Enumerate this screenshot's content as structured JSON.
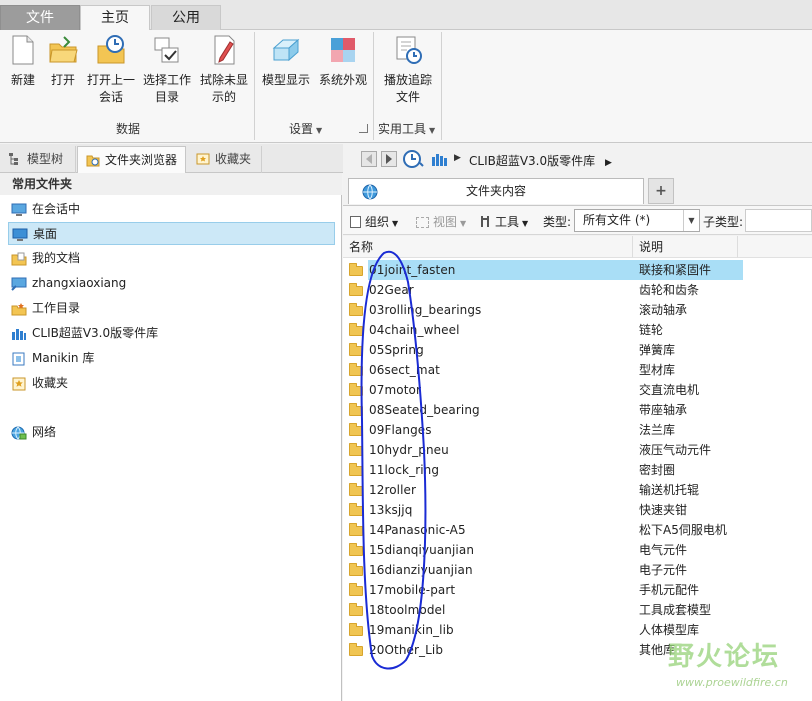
{
  "ribbon_tabs": [
    "文件",
    "主页",
    "公用"
  ],
  "ribbon": {
    "buttons": [
      {
        "label": "新建",
        "icon": "new-file-icon"
      },
      {
        "label": "打开",
        "icon": "open-folder-icon"
      },
      {
        "label": "打开上一\n会话",
        "icon": "open-last-session-icon"
      },
      {
        "label": "选择工作\n目录",
        "icon": "select-working-dir-icon"
      },
      {
        "label": "拭除未显\n示的",
        "icon": "erase-not-displayed-icon"
      },
      {
        "label": "模型显示",
        "icon": "model-display-icon"
      },
      {
        "label": "系统外观",
        "icon": "system-appearance-icon"
      },
      {
        "label": "播放追踪\n文件",
        "icon": "play-trail-file-icon"
      }
    ],
    "groups": [
      "数据",
      "设置",
      "实用工具"
    ]
  },
  "left_tabs": [
    {
      "label": "模型树",
      "icon": "model-tree-icon"
    },
    {
      "label": "文件夹浏览器",
      "icon": "folder-browser-icon"
    },
    {
      "label": "收藏夹",
      "icon": "favorites-icon"
    }
  ],
  "left_panel": {
    "header": "常用文件夹",
    "items": [
      {
        "label": "在会话中",
        "icon": "monitor-icon"
      },
      {
        "label": "桌面",
        "icon": "desktop-icon",
        "selected": true
      },
      {
        "label": "我的文档",
        "icon": "documents-icon"
      },
      {
        "label": "zhangxiaoxiang",
        "icon": "computer-icon"
      },
      {
        "label": "工作目录",
        "icon": "working-dir-icon"
      },
      {
        "label": "CLIB超蓝V3.0版零件库",
        "icon": "library-icon"
      },
      {
        "label": "Manikin 库",
        "icon": "manikin-library-icon"
      },
      {
        "label": "收藏夹",
        "icon": "favorites-icon"
      },
      {
        "label": "网络",
        "icon": "network-icon"
      }
    ]
  },
  "breadcrumb": {
    "path": "CLIB超蓝V3.0版零件库"
  },
  "content_tab": {
    "label": "文件夹内容",
    "add_label": "+"
  },
  "toolbar": {
    "organize": "组织",
    "view": "视图",
    "tools": "工具",
    "type_label": "类型:",
    "type_value": "所有文件 (*)",
    "subtype_label": "子类型:"
  },
  "columns": {
    "name": "名称",
    "desc": "说明"
  },
  "files": [
    {
      "name": "01joint_fasten",
      "desc": "联接和紧固件",
      "selected": true
    },
    {
      "name": "02Gear",
      "desc": "齿轮和齿条"
    },
    {
      "name": "03rolling_bearings",
      "desc": "滚动轴承"
    },
    {
      "name": "04chain_wheel",
      "desc": "链轮"
    },
    {
      "name": "05Spring",
      "desc": "弹簧库"
    },
    {
      "name": "06sect_mat",
      "desc": "型材库"
    },
    {
      "name": "07motor",
      "desc": "交直流电机"
    },
    {
      "name": "08Seated_bearing",
      "desc": "带座轴承"
    },
    {
      "name": "09Flanges",
      "desc": "法兰库"
    },
    {
      "name": "10hydr_pneu",
      "desc": "液压气动元件"
    },
    {
      "name": "11lock_ring",
      "desc": "密封圈"
    },
    {
      "name": "12roller",
      "desc": "输送机托辊"
    },
    {
      "name": "13ksjjq",
      "desc": "快速夹钳"
    },
    {
      "name": "14Panasonic-A5",
      "desc": "松下A5伺服电机"
    },
    {
      "name": "15dianqiyuanjian",
      "desc": "电气元件"
    },
    {
      "name": "16dianziyuanjian",
      "desc": "电子元件"
    },
    {
      "name": "17mobile-part",
      "desc": "手机元配件"
    },
    {
      "name": "18toolmodel",
      "desc": "工具成套模型"
    },
    {
      "name": "19manikin_lib",
      "desc": "人体模型库"
    },
    {
      "name": "20Other_Lib",
      "desc": "其他库"
    }
  ],
  "watermark": {
    "text": "野火论坛",
    "url": "www.proewildfire.cn"
  },
  "colors": {
    "selection": "#a9def6",
    "folder": "#f0c552",
    "annotation": "#1a2bd4",
    "watermark": "#96d278"
  }
}
